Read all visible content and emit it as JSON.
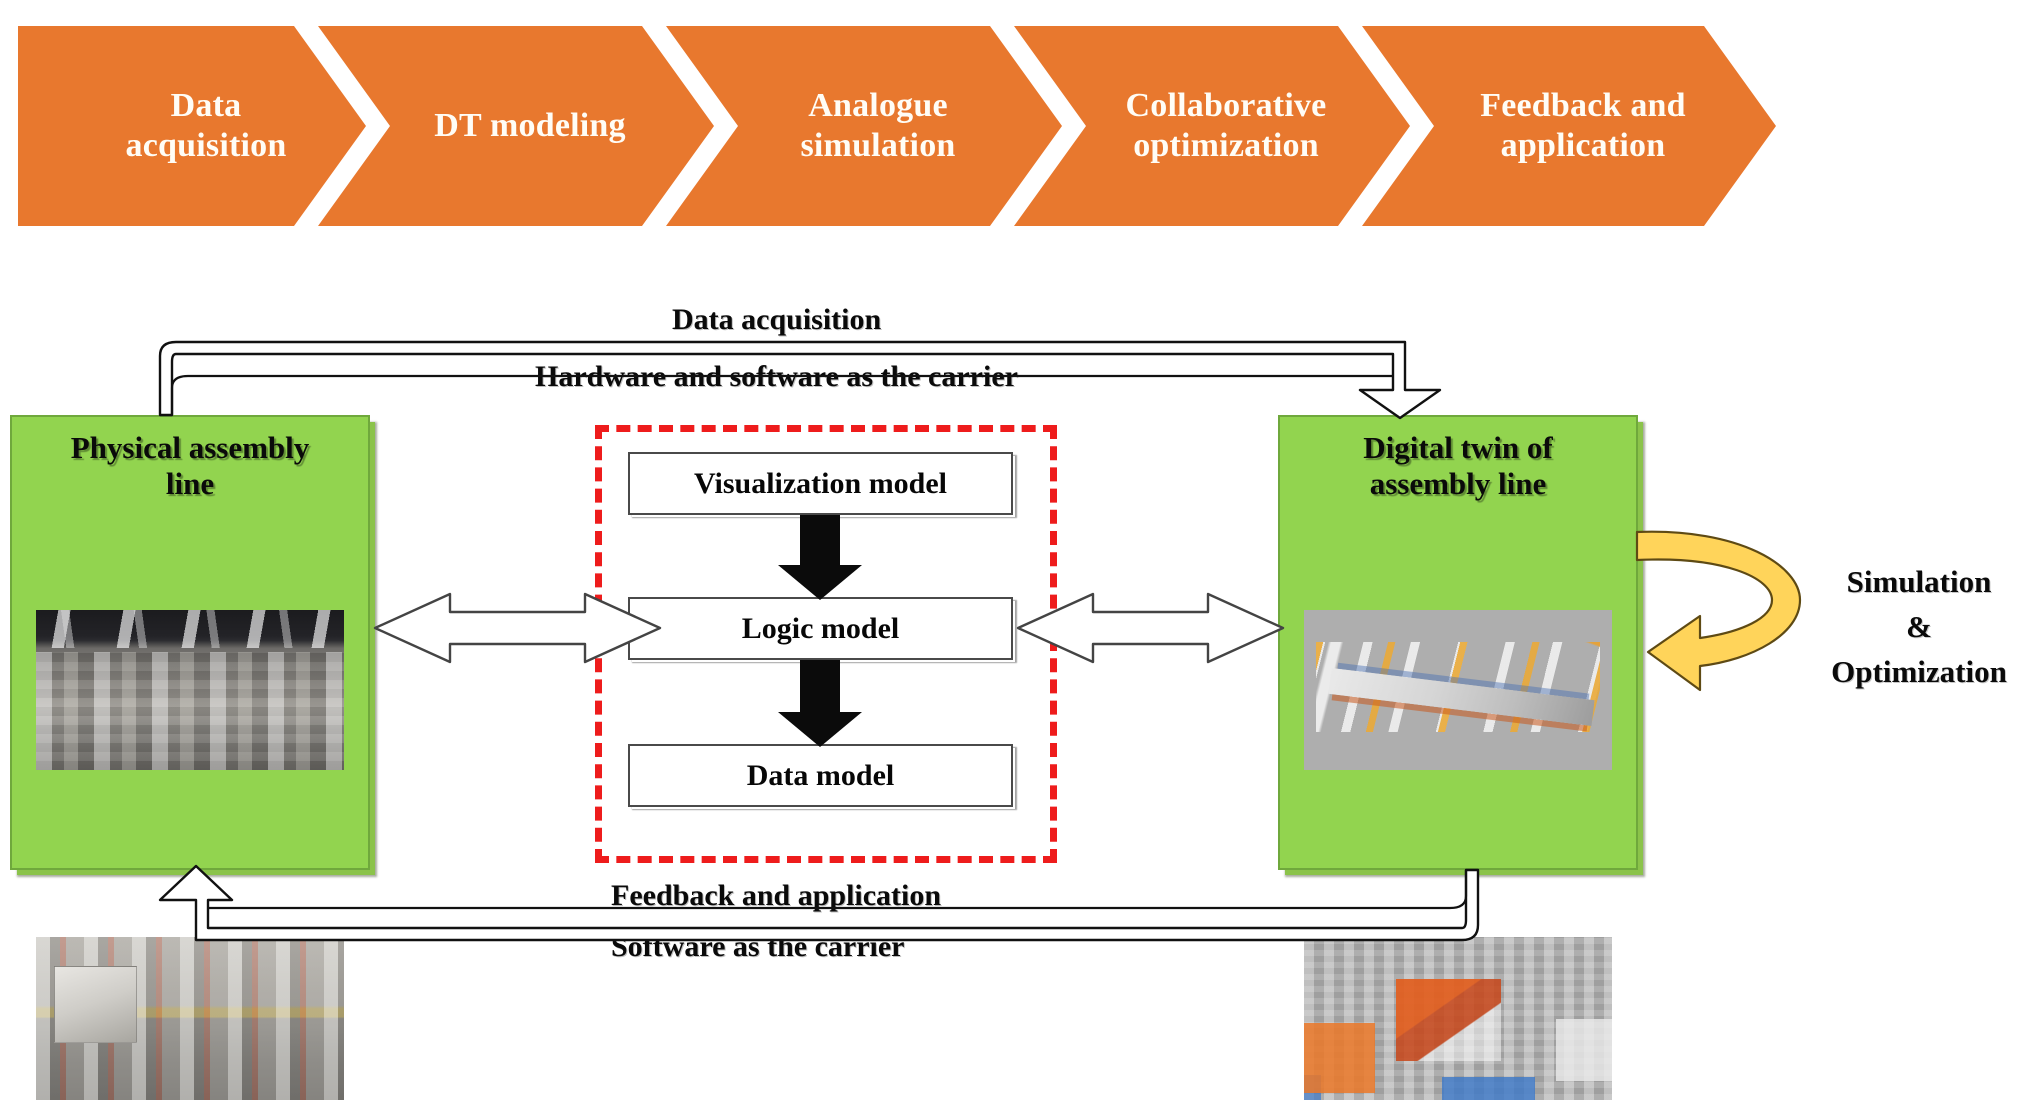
{
  "banner": {
    "accent_color": "#E8782E",
    "text_color": "#FFFDF6",
    "steps": [
      {
        "label": "Data\nacquisition"
      },
      {
        "label": "DT modeling"
      },
      {
        "label": "Analogue\nsimulation"
      },
      {
        "label": "Collaborative\noptimization"
      },
      {
        "label": "Feedback and\napplication"
      }
    ]
  },
  "diagram": {
    "left_box": {
      "title": "Physical assembly\nline",
      "fill_color": "#92D44F",
      "photos": [
        "factory-interior-photo",
        "robot-cell-photo"
      ]
    },
    "right_box": {
      "title": "Digital twin of\nassembly line",
      "fill_color": "#92D44F",
      "photos": [
        "digital-twin-line-render",
        "digital-twin-cell-render"
      ]
    },
    "center_group": {
      "border_color": "#EE1C1C",
      "models": [
        {
          "label": "Visualization model"
        },
        {
          "label": "Logic model"
        },
        {
          "label": "Data model"
        }
      ]
    },
    "top_flow": {
      "line1": "Data acquisition",
      "line2": "Hardware and software as the carrier"
    },
    "bottom_flow": {
      "line1": "Feedback and application",
      "line2": "Software as the carrier"
    },
    "right_loop": {
      "label": "Simulation\n&\nOptimization",
      "arrow_color": "#FFD45A"
    }
  }
}
